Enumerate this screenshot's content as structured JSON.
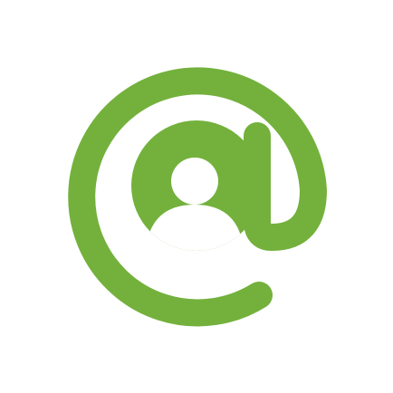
{
  "icon": {
    "name": "at-sign-user-icon",
    "description_role": "logo"
  },
  "colors": {
    "background": "#ffffff",
    "accent": "#73b13c"
  }
}
